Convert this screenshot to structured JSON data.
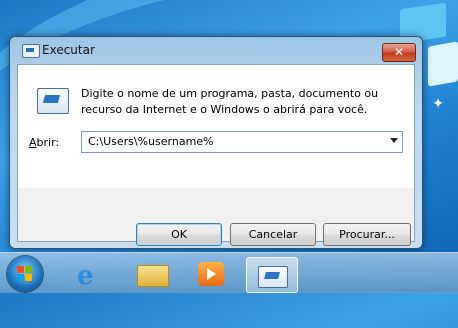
{
  "window": {
    "title": "Executar",
    "close_glyph": "✕",
    "description": "Digite o nome de um programa, pasta, documento ou recurso da Internet e o Windows o abrirá para você.",
    "open_label": "Abrir:",
    "open_value": "C:\\Users\\%username%",
    "buttons": {
      "ok": "OK",
      "cancel": "Cancelar",
      "browse": "Procurar..."
    }
  },
  "taskbar": {
    "items": [
      {
        "name": "start-button",
        "icon": "windows-logo-icon"
      },
      {
        "name": "internet-explorer",
        "icon": "internet-explorer-icon"
      },
      {
        "name": "windows-explorer",
        "icon": "folder-icon"
      },
      {
        "name": "media-player",
        "icon": "media-player-icon"
      },
      {
        "name": "run-dialog",
        "icon": "run-icon",
        "active": true
      }
    ]
  },
  "colors": {
    "accent": "#2b73c4",
    "close_button": "#c0391f"
  }
}
